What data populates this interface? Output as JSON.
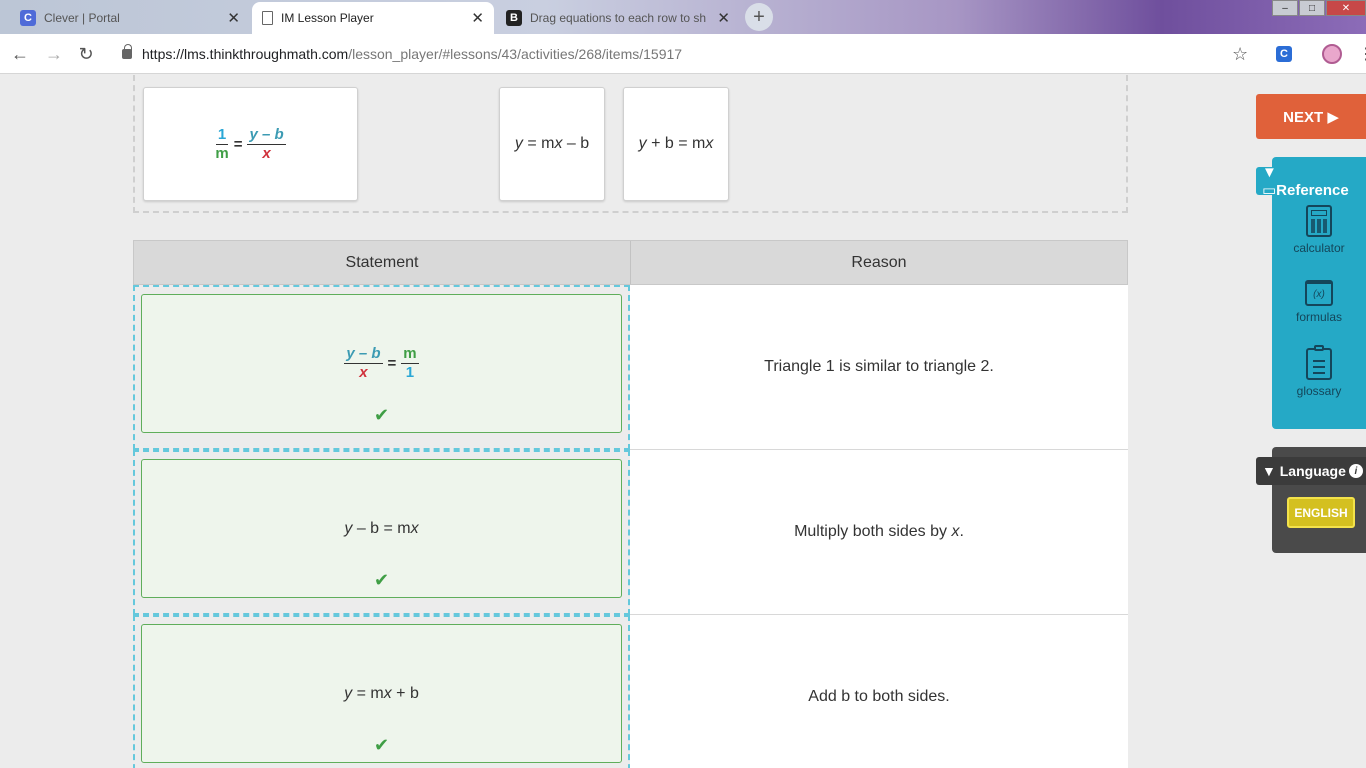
{
  "browser": {
    "tabs": [
      {
        "title": "Clever | Portal",
        "favicon": "C",
        "active": false
      },
      {
        "title": "IM Lesson Player",
        "favicon": "doc-icon",
        "active": true
      },
      {
        "title": "Drag equations to each row to sh",
        "favicon": "B",
        "active": false
      }
    ],
    "close_glyph": "✕",
    "new_tab_glyph": "+",
    "url_host": "https://lms.thinkthroughmath.com",
    "url_path": "/lesson_player/#lessons/43/activities/268/items/15917",
    "ext_c_label": "C"
  },
  "tray": {
    "card1": {
      "lhs_num": "1",
      "lhs_den": "m",
      "eq": "=",
      "rhs_num": "y – b",
      "rhs_den": "x"
    },
    "card2": {
      "y": "y",
      "rest1": " = m",
      "x": "x",
      "rest2": " – b"
    },
    "card3": {
      "y": "y",
      "rest1": " + b = m",
      "x": "x"
    }
  },
  "table": {
    "headers": [
      "Statement",
      "Reason"
    ],
    "rows": [
      {
        "statement": {
          "lhs_num": "y – b",
          "lhs_den": "x",
          "eq": "=",
          "rhs_num": "m",
          "rhs_den": "1"
        },
        "reason": "Triangle 1 is similar to triangle 2."
      },
      {
        "statement": {
          "y": "y",
          "rest1": " – b = m",
          "x": "x"
        },
        "reason_text": "Multiply both sides by ",
        "reason_var": "x",
        "reason_end": "."
      },
      {
        "statement": {
          "y": "y",
          "rest1": " = m",
          "x": "x",
          "rest2": " + b"
        },
        "reason": "Add b to both sides."
      }
    ],
    "check_glyph": "✔"
  },
  "panel": {
    "next_label": "NEXT ▶",
    "reference_label": "▼ ▭Reference",
    "reference_items": [
      "calculator",
      "formulas",
      "glossary"
    ],
    "formulas_glyph": "(x)",
    "language_label": "▼ Language",
    "info_glyph": "i",
    "language_button": "ENGLISH"
  },
  "colors": {
    "next": "#e0613a",
    "reference": "#25a9c6",
    "correct": "#3f9e45",
    "language_button": "#d4c020"
  }
}
